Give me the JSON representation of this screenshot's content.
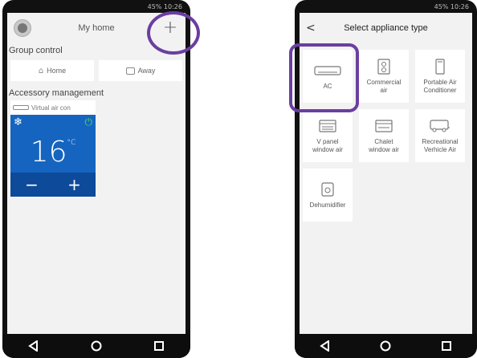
{
  "left": {
    "status_text": "45% 10:26",
    "header": {
      "title": "My home",
      "add_label": "+"
    },
    "group_control": {
      "title": "Group control",
      "buttons": [
        {
          "label": "Home"
        },
        {
          "label": "Away"
        }
      ]
    },
    "accessory": {
      "title": "Accessory management",
      "device_name": "Virtual air con",
      "temperature": "16",
      "unit": "°C",
      "minus_label": "−",
      "plus_label": "+"
    }
  },
  "right": {
    "status_text": "45% 10:26",
    "header": {
      "title": "Select appliance type",
      "back_label": "<"
    },
    "tiles": [
      {
        "label": "AC",
        "icon": "ac-unit-icon"
      },
      {
        "label": "Commercial\nair",
        "icon": "commercial-air-icon"
      },
      {
        "label": "Portable Air\nConditioner",
        "icon": "portable-ac-icon"
      },
      {
        "label": "V panel\nwindow air",
        "icon": "window-air-icon"
      },
      {
        "label": "Chalet\nwindow air",
        "icon": "chalet-window-icon"
      },
      {
        "label": "Recreational\nVerhicle Air",
        "icon": "rv-air-icon"
      },
      {
        "label": "Dehumidifier",
        "icon": "dehumidifier-icon"
      }
    ]
  },
  "colors": {
    "accent": "#6a3fa0",
    "panel": "#1565c0",
    "power": "#4cd964"
  }
}
